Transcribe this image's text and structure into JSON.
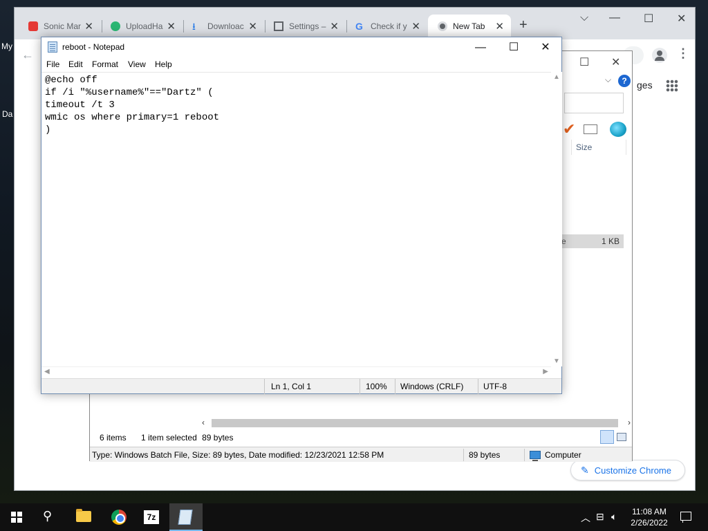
{
  "desktop": {
    "icon_label_top": "My",
    "icon_label_mid": "Da"
  },
  "chrome": {
    "tabs": [
      {
        "title": "Sonic Mar",
        "icon": "red-lock-icon"
      },
      {
        "title": "UploadHa",
        "icon": "upload-icon"
      },
      {
        "title": "Downloac",
        "icon": "download-icon"
      },
      {
        "title": "Settings –",
        "icon": "settings-icon"
      },
      {
        "title": "Check if y",
        "icon": "google-icon"
      },
      {
        "title": "New Tab",
        "icon": "chrome-icon"
      }
    ],
    "tab_close": "✕",
    "new_tab": "+",
    "images_link": "ges",
    "customize_label": "Customize Chrome"
  },
  "explorer": {
    "col_size": "Size",
    "selected_row_name_fragment": "e",
    "selected_row_size": "1 KB",
    "status_items": "6 items",
    "status_selected": "1 item selected",
    "status_bytes": "89 bytes",
    "info_type": "Type: Windows Batch File, Size: 89 bytes, Date modified: 12/23/2021 12:58 PM",
    "info_size": "89 bytes",
    "info_location": "Computer"
  },
  "notepad": {
    "title": "reboot - Notepad",
    "menu": [
      "File",
      "Edit",
      "Format",
      "View",
      "Help"
    ],
    "content": "@echo off\nif /i \"%username%\"==\"Dartz\" (\ntimeout /t 3\nwmic os where primary=1 reboot\n)",
    "status": {
      "position": "Ln 1, Col 1",
      "zoom": "100%",
      "line_ending": "Windows (CRLF)",
      "encoding": "UTF-8"
    }
  },
  "taskbar": {
    "time": "11:08 AM",
    "date": "2/26/2022",
    "sevenzip_label": "7z"
  },
  "colors": {
    "accent": "#1a73e8",
    "taskbar_bg": "#101010",
    "active_indicator": "#76b9ed"
  }
}
